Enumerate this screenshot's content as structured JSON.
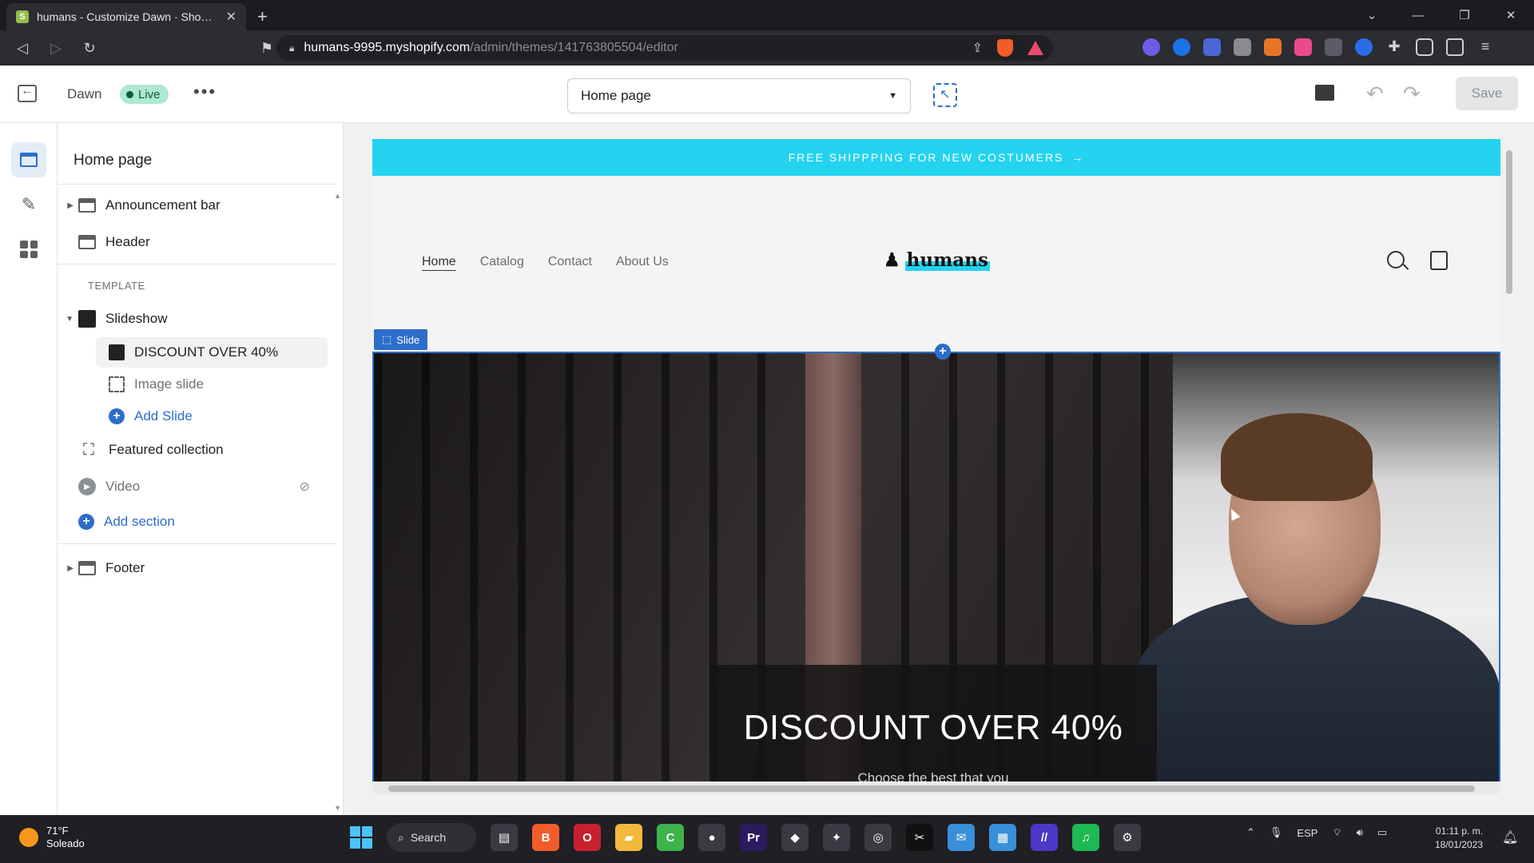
{
  "browser": {
    "tab_title": "humans - Customize Dawn · Shopify",
    "new_tab": "+",
    "url_host": "humans-9995.myshopify.com",
    "url_path": "/admin/themes/141763805504/editor"
  },
  "editor": {
    "theme_name": "Dawn",
    "live_label": "Live",
    "more": "•••",
    "page_select": "Home page",
    "save_label": "Save",
    "undo": "↶",
    "redo": "↷"
  },
  "sidebar": {
    "title": "Home page",
    "announcement_bar": "Announcement bar",
    "header": "Header",
    "template_label": "TEMPLATE",
    "slideshow": "Slideshow",
    "slide_discount": "DISCOUNT OVER 40%",
    "image_slide": "Image slide",
    "add_slide": "Add Slide",
    "featured_collection": "Featured collection",
    "video": "Video",
    "add_section": "Add section",
    "footer": "Footer"
  },
  "storefront": {
    "announcement": "FREE SHIPPPING FOR NEW COSTUMERS",
    "announcement_arrow": "→",
    "nav": [
      "Home",
      "Catalog",
      "Contact",
      "About Us"
    ],
    "logo": "humans",
    "slide_tag": "Slide",
    "slide_heading": "DISCOUNT OVER 40%",
    "slide_subheading": "Choose the best that you"
  },
  "taskbar": {
    "temperature": "71°F",
    "weather": "Soleado",
    "search": "Search",
    "apps": [
      {
        "name": "file-explorer",
        "label": "▤",
        "color": "#3a3a42"
      },
      {
        "name": "brave",
        "label": "B",
        "color": "#f25c2a"
      },
      {
        "name": "opera",
        "label": "O",
        "color": "#c9202f"
      },
      {
        "name": "folder",
        "label": "▰",
        "color": "#f3b93c"
      },
      {
        "name": "camtasia",
        "label": "C",
        "color": "#3db34a"
      },
      {
        "name": "obs",
        "label": "●",
        "color": "#3a3a42"
      },
      {
        "name": "premiere",
        "label": "Pr",
        "color": "#2a1a5e"
      },
      {
        "name": "nvidia",
        "label": "◆",
        "color": "#3a3a42"
      },
      {
        "name": "davinci",
        "label": "✦",
        "color": "#3a3a42"
      },
      {
        "name": "chrome",
        "label": "◎",
        "color": "#3a3a42"
      },
      {
        "name": "capcut",
        "label": "✂",
        "color": "#111111"
      },
      {
        "name": "mail",
        "label": "✉",
        "color": "#3a8fd9"
      },
      {
        "name": "store",
        "label": "▦",
        "color": "#3a8fd9"
      },
      {
        "name": "after-effects",
        "label": "//",
        "color": "#4b37c8"
      },
      {
        "name": "spotify",
        "label": "♫",
        "color": "#1db954"
      },
      {
        "name": "settings",
        "label": "⚙",
        "color": "#3a3a42"
      }
    ],
    "lang": "ESP",
    "time": "01:11 p. m.",
    "date": "18/01/2023"
  },
  "colors": {
    "accent": "#2c6ecb",
    "announcement_bg": "#24d3ef",
    "live_badge": "#aee9d1"
  }
}
